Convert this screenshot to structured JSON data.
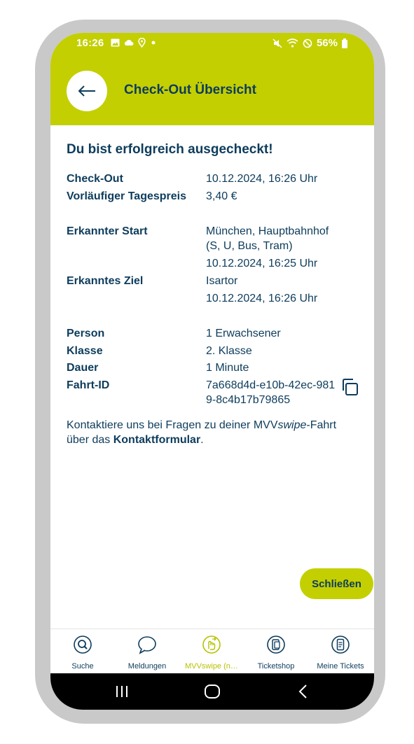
{
  "status_bar": {
    "time": "16:26",
    "battery": "56%"
  },
  "header": {
    "title": "Check-Out Übersicht",
    "back_icon": "arrow-left-icon"
  },
  "content": {
    "success_message": "Du bist erfolgreich ausgecheckt!",
    "details": [
      {
        "label": "Check-Out",
        "value": "10.12.2024, 16:26 Uhr"
      },
      {
        "label": "Vorläufiger Tagespreis",
        "value": "3,40 €"
      },
      {
        "label": "Erkannter Start",
        "value": "München, Hauptbahnhof (S, U, Bus, Tram)",
        "time": "10.12.2024, 16:25 Uhr"
      },
      {
        "label": "Erkanntes Ziel",
        "value": "Isartor",
        "time": "10.12.2024, 16:26 Uhr"
      },
      {
        "label": "Person",
        "value": "1 Erwachsener"
      },
      {
        "label": "Klasse",
        "value": "2. Klasse"
      },
      {
        "label": "Dauer",
        "value": "1 Minute"
      },
      {
        "label": "Fahrt-ID",
        "value": "7a668d4d-e10b-42ec-9819-8c4b17b79865"
      }
    ],
    "contact": {
      "text_before": "Kontaktiere uns bei Fragen zu deiner MVV",
      "brand_italic": "swipe",
      "text_middle": "-Fahrt über das ",
      "link_label": "Kontaktformular",
      "text_after": "."
    },
    "close_button": "Schließen"
  },
  "tabs": [
    {
      "label": "Suche",
      "icon": "search-icon"
    },
    {
      "label": "Meldungen",
      "icon": "speech-bubble-icon"
    },
    {
      "label": "MVVswipe (n…",
      "icon": "swipe-hand-icon",
      "active": true
    },
    {
      "label": "Ticketshop",
      "icon": "ticket-phone-icon"
    },
    {
      "label": "Meine Tickets",
      "icon": "ticket-icon"
    }
  ],
  "colors": {
    "accent": "#c3cf00",
    "text": "#0d3c5c",
    "frame": "#c9c9c9"
  }
}
